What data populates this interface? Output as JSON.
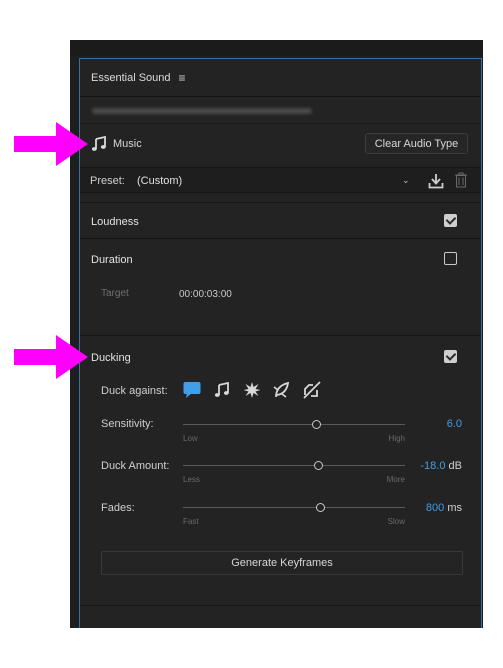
{
  "panel": {
    "title": "Essential Sound",
    "menu_icon": "hamburger-icon",
    "clip_name_blurred": "███ ████ ████"
  },
  "audio_type": {
    "icon": "music-note-icon",
    "label": "Music",
    "clear_button": "Clear Audio Type"
  },
  "preset": {
    "label": "Preset:",
    "value": "(Custom)",
    "chevron_icon": "chevron-down-icon",
    "download_icon": "download-icon",
    "delete_icon": "trash-icon"
  },
  "loudness": {
    "title": "Loudness",
    "checked": true
  },
  "duration": {
    "title": "Duration",
    "checked": false,
    "target_label": "Target",
    "target_value": "00:00:03:00"
  },
  "ducking": {
    "title": "Ducking",
    "checked": true,
    "duck_against_label": "Duck against:",
    "duck_against_icons": [
      "dialogue-bubble-icon",
      "music-note-icon",
      "sfx-burst-icon",
      "ambience-icon",
      "unassigned-icon"
    ],
    "sensitivity": {
      "label": "Sensitivity:",
      "low": "Low",
      "high": "High",
      "value": "6.0",
      "unit": "",
      "fraction": 0.6
    },
    "duck_amount": {
      "label": "Duck Amount:",
      "low": "Less",
      "high": "More",
      "value": "-18.0",
      "unit": "dB",
      "fraction": 0.61
    },
    "fades": {
      "label": "Fades:",
      "low": "Fast",
      "high": "Slow",
      "value": "800",
      "unit": "ms",
      "fraction": 0.62
    },
    "generate_button": "Generate Keyframes"
  },
  "colors": {
    "accent_blue": "#3f9fe8",
    "annotation_magenta": "#ff00ff",
    "panel_bg": "#232323"
  }
}
